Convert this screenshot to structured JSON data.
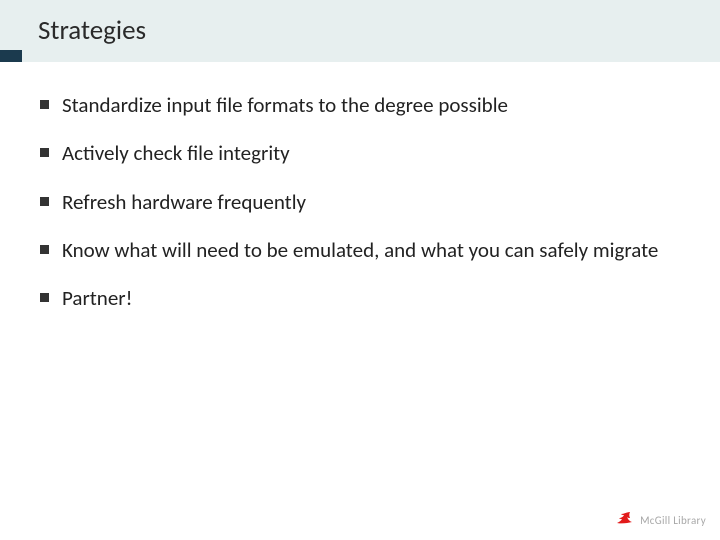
{
  "header": {
    "title": "Strategies"
  },
  "bullets": [
    "Standardize input file formats to the degree possible",
    "Actively check file integrity",
    "Refresh hardware frequently",
    "Know what will need to be emulated, and what you can safely migrate",
    "Partner!"
  ],
  "footer": {
    "brand": "McGill Library"
  }
}
